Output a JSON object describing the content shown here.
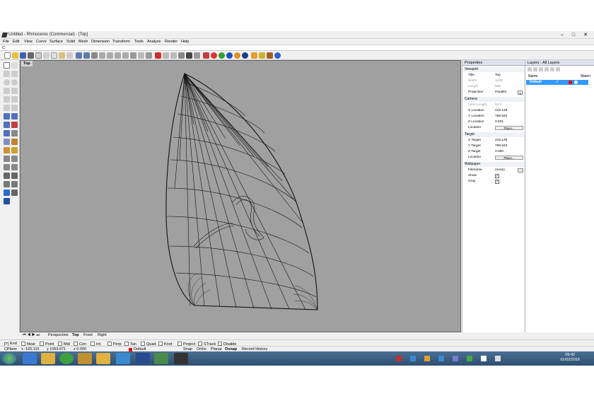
{
  "window": {
    "title": "Untitled - Rhinoceros (Commercial) - [Top]",
    "min": "–",
    "max": "□",
    "close": "✕"
  },
  "menu": [
    "File",
    "Edit",
    "View",
    "Curve",
    "Surface",
    "Solid",
    "Mesh",
    "Dimension",
    "Transform",
    "Tools",
    "Analyze",
    "Render",
    "Help"
  ],
  "command": {
    "prompt": "C"
  },
  "viewport": {
    "label": "Top"
  },
  "properties": {
    "header": "Properties",
    "sections": {
      "viewport": "Viewport",
      "camera": "Camera",
      "target": "Target",
      "wallpaper": "Wallpaper"
    },
    "viewport_rows": [
      {
        "k": "Title",
        "v": "Top"
      },
      {
        "k": "Width",
        "v": "1639"
      },
      {
        "k": "Height",
        "v": "806"
      },
      {
        "k": "Projection",
        "v": "Parallel"
      }
    ],
    "camera_rows": [
      {
        "k": "Lens Length",
        "v": "50.0"
      },
      {
        "k": "X Location",
        "v": "215.148"
      },
      {
        "k": "Y Location",
        "v": "798.843"
      },
      {
        "k": "Z Location",
        "v": "0.501"
      },
      {
        "k": "Location",
        "v": "Place..."
      }
    ],
    "target_rows": [
      {
        "k": "X Target",
        "v": "215.148"
      },
      {
        "k": "Y Target",
        "v": "798.843"
      },
      {
        "k": "Z Target",
        "v": "0.000"
      },
      {
        "k": "Location",
        "v": "Place..."
      }
    ],
    "wallpaper_rows": [
      {
        "k": "Filename",
        "v": "(none)"
      },
      {
        "k": "Show",
        "v": "✓"
      },
      {
        "k": "Gray",
        "v": "✓"
      }
    ]
  },
  "layers": {
    "header": "Layers - All Layers",
    "col_name": "Name",
    "col_material": "Materi",
    "default_layer": "Default",
    "check": "✓"
  },
  "view_tabs": [
    "Perspective",
    "Top",
    "Front",
    "Right"
  ],
  "osnaps": [
    {
      "label": "End",
      "on": true
    },
    {
      "label": "Near",
      "on": false
    },
    {
      "label": "Point",
      "on": false
    },
    {
      "label": "Mid",
      "on": false
    },
    {
      "label": "Cen",
      "on": false
    },
    {
      "label": "Int",
      "on": false
    },
    {
      "label": "Perp",
      "on": false
    },
    {
      "label": "Tan",
      "on": false
    },
    {
      "label": "Quad",
      "on": false
    },
    {
      "label": "Knot",
      "on": false
    },
    {
      "label": "Project",
      "on": false
    },
    {
      "label": "STrack",
      "on": false
    },
    {
      "label": "Disable",
      "on": false
    }
  ],
  "status": {
    "cplane": "CPlane",
    "x": "x -165.191",
    "y": "y 1053.071",
    "z": "z 0.000",
    "layer": "Default",
    "toggles": [
      "Snap",
      "Ortho",
      "Planar",
      "Osnap",
      "Record History"
    ]
  },
  "clock": {
    "time": "09:42",
    "date": "01/02/2016"
  },
  "colors": {
    "viewport": "#a0a0a0",
    "accent": "#3399ff",
    "layer_color": "#e01010"
  }
}
